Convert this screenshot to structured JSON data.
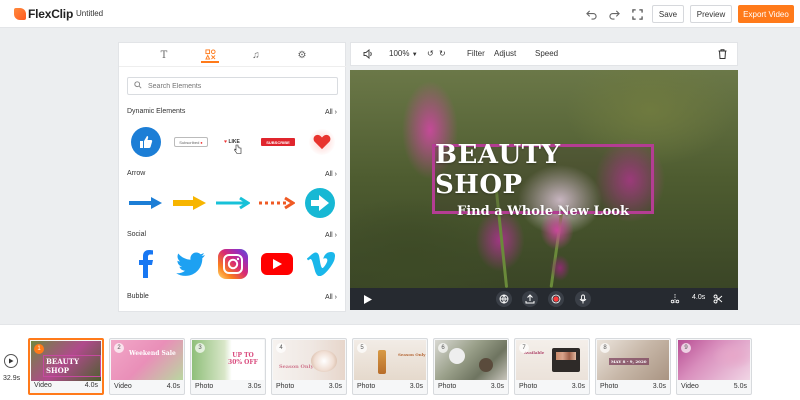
{
  "app": {
    "logo": "FlexClip",
    "doc_title": "Untitled"
  },
  "toolbar": {
    "save_label": "Save",
    "preview_label": "Preview",
    "export_label": "Export Video"
  },
  "panel": {
    "tabs": [
      "text-tab",
      "elements-tab",
      "music-tab",
      "settings-tab"
    ],
    "search_placeholder": "Search Elements",
    "sections": [
      {
        "title": "Dynamic Elements",
        "all": "All",
        "items": [
          "thumbs-up",
          "subscribed",
          "like",
          "subscribe",
          "heart"
        ]
      },
      {
        "title": "Arrow",
        "all": "All",
        "items": [
          "arrow-blue",
          "arrow-yellow",
          "arrow-cyan",
          "arrow-dashed-orange",
          "arrow-circle"
        ]
      },
      {
        "title": "Social",
        "all": "All",
        "items": [
          "facebook",
          "twitter",
          "instagram",
          "youtube",
          "vimeo"
        ]
      },
      {
        "title": "Bubble",
        "all": "All",
        "items": []
      }
    ],
    "dyn_labels": {
      "subscribed": "Subscribed",
      "like": "LIKE",
      "subscribe": "SUBSCRIBE"
    }
  },
  "preview": {
    "zoom": "100%",
    "filter_label": "Filter",
    "adjust_label": "Adjust",
    "speed_label": "Speed",
    "title_main": "BEAUTY SHOP",
    "title_sub": "Find a Whole New Look",
    "duration": "4.0s"
  },
  "timeline": {
    "total": "32.9s",
    "clips": [
      {
        "n": "1",
        "type": "Video",
        "dur": "4.0s",
        "text": "BEAUTY SHOP"
      },
      {
        "n": "2",
        "type": "Video",
        "dur": "4.0s",
        "text": "Weekend Sale"
      },
      {
        "n": "3",
        "type": "Photo",
        "dur": "3.0s",
        "text": "UP TO 30% OFF"
      },
      {
        "n": "4",
        "type": "Photo",
        "dur": "3.0s",
        "text": "Season Only"
      },
      {
        "n": "5",
        "type": "Photo",
        "dur": "3.0s",
        "text": "Season Only"
      },
      {
        "n": "6",
        "type": "Photo",
        "dur": "3.0s",
        "text": ""
      },
      {
        "n": "7",
        "type": "Photo",
        "dur": "3.0s",
        "text": "Available"
      },
      {
        "n": "8",
        "type": "Photo",
        "dur": "3.0s",
        "text": "MAY 8 - 9, 2020"
      },
      {
        "n": "9",
        "type": "Video",
        "dur": "5.0s",
        "text": ""
      }
    ]
  },
  "colors": {
    "accent": "#ff7a1a",
    "title_border": "#b43d93",
    "facebook": "#1877f2",
    "twitter": "#1da1f2",
    "youtube": "#ff0000",
    "vimeo": "#1ab7ea"
  }
}
